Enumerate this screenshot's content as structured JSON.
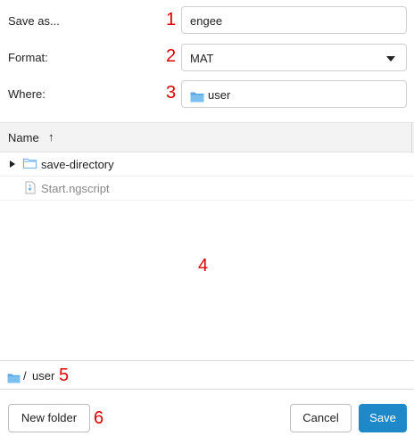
{
  "form": {
    "save_as": {
      "label": "Save as...",
      "value": "engee"
    },
    "format": {
      "label": "Format:",
      "value": "MAT"
    },
    "where": {
      "label": "Where:",
      "value": "user"
    }
  },
  "file_list": {
    "column_header": "Name",
    "sort_indicator": "↑",
    "items": [
      {
        "name": "save-directory",
        "type": "folder",
        "icon": "folder-icon"
      },
      {
        "name": "Start.ngscript",
        "type": "script",
        "icon": "script-file-icon"
      }
    ]
  },
  "path_bar": {
    "separator": "/",
    "current": "user"
  },
  "buttons": {
    "new_folder": "New folder",
    "cancel": "Cancel",
    "save": "Save"
  },
  "annotations": [
    "1",
    "2",
    "3",
    "4",
    "5",
    "6"
  ],
  "colors": {
    "accent": "#1e88c8",
    "annotation": "#e00000",
    "folder": "#5aa8e6"
  }
}
